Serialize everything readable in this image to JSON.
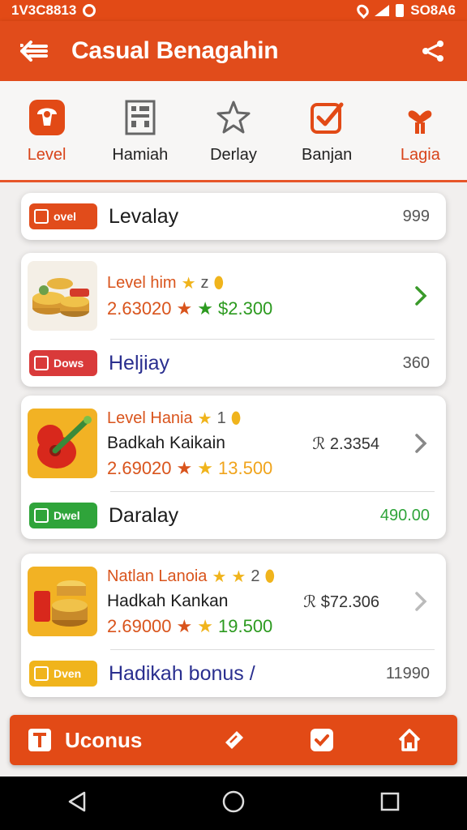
{
  "status_bar": {
    "time": "1V3C8813",
    "carrier": "SO8A6"
  },
  "app_bar": {
    "title": "Casual Benagahin"
  },
  "tabs": [
    {
      "label": "Level",
      "icon": "gift-icon",
      "active": true
    },
    {
      "label": "Hamiah",
      "icon": "building-icon"
    },
    {
      "label": "Derlay",
      "icon": "star-icon"
    },
    {
      "label": "Banjan",
      "icon": "checkbox-icon"
    },
    {
      "label": "Lagia",
      "icon": "heart-icon"
    }
  ],
  "cards": [
    {
      "type": "simple",
      "badge": "ovel",
      "badge_color": "#e14c1b",
      "title": "Levalay",
      "value": "999"
    },
    {
      "type": "game",
      "level": "Level him",
      "level_suffix": "z",
      "name": "",
      "price": "",
      "score": "2.63020",
      "score_green": "$2.300",
      "footer": {
        "badge": "Dows",
        "badge_color": "#d93a3a",
        "title": "Heljiay",
        "value": "360",
        "title_color": "#2a2f8f"
      }
    },
    {
      "type": "game",
      "level": "Level Hania",
      "level_suffix": "1",
      "name": "Badkah Kaikain",
      "price": "ℛ 2.3354",
      "score": "2.69020",
      "score_green": "13.500",
      "footer": {
        "badge": "Dwel",
        "badge_color": "#2fa43a",
        "title": "Daralay",
        "value": "490.00",
        "title_color": "#1c1c1c",
        "value_color": "#2fa43a"
      }
    },
    {
      "type": "game",
      "level": "Natlan Lanoia",
      "level_suffix": "2",
      "name": "Hadkah Kankan",
      "price": "ℛ $72.306",
      "score": "2.69000",
      "score_green": "19.500",
      "footer": {
        "badge": "Dven",
        "badge_color": "#f0b41c",
        "title": "Hadikah bonus /",
        "value": "11990",
        "title_color": "#2a2f8f"
      }
    }
  ],
  "bottom_bar": {
    "label": "Uconus"
  },
  "colors": {
    "accent": "#e14c1b",
    "green": "#2c9a1f",
    "gold": "#f0b41c"
  }
}
